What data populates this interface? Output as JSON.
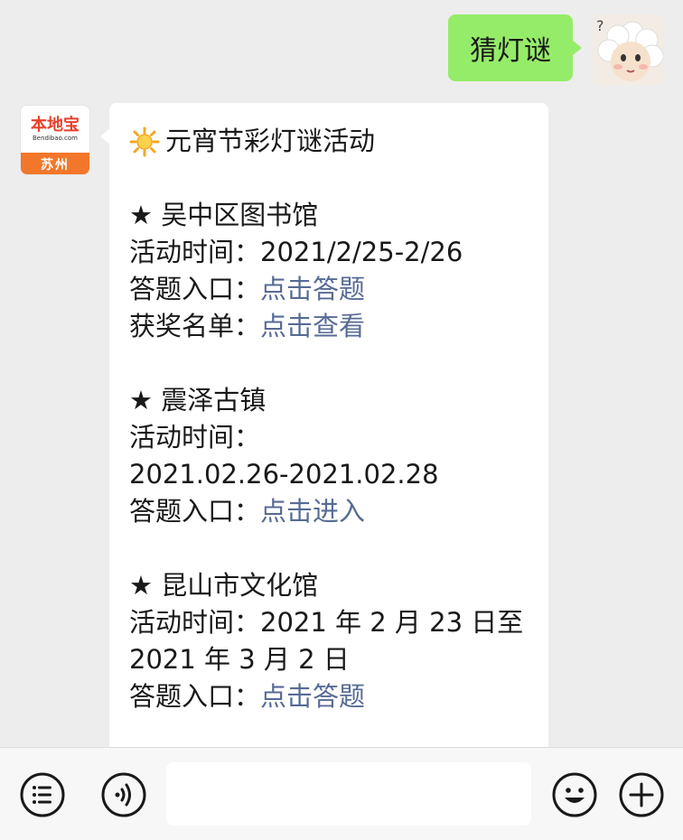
{
  "outgoing": {
    "text": "猜灯谜"
  },
  "incoming": {
    "sender_logo": {
      "name": "本地宝",
      "domain": "Bendibao.com",
      "city": "苏州"
    },
    "title": "元宵节彩灯谜活动",
    "events": [
      {
        "name": "★ 吴中区图书馆",
        "lines": [
          {
            "label": "活动时间：",
            "value": "2021/2/25-2/26",
            "link": false
          },
          {
            "label": "答题入口：",
            "value": "点击答题",
            "link": true
          },
          {
            "label": "获奖名单：",
            "value": "点击查看",
            "link": true
          }
        ]
      },
      {
        "name": "★ 震泽古镇",
        "time_label": "活动时间：",
        "time_value": "2021.02.26-2021.02.28",
        "entry_label": "答题入口：",
        "entry_link": "点击进入"
      },
      {
        "name": "★ 昆山市文化馆",
        "time_label": "活动时间：",
        "time_value_1": "2021 年 2 月 23 日至",
        "time_value_2": "2021 年 3 月 2 日",
        "entry_label": "答题入口：",
        "entry_link": "点击答题"
      }
    ]
  },
  "input_bar": {
    "left_icons": [
      "menu-list-icon",
      "voice-icon"
    ],
    "right_icons": [
      "emoji-icon",
      "plus-icon"
    ]
  },
  "colors": {
    "background": "#ededed",
    "outgoing_bubble": "#95ec69",
    "link": "#576b95",
    "logo_red": "#e5412a",
    "logo_orange": "#f2772a"
  }
}
